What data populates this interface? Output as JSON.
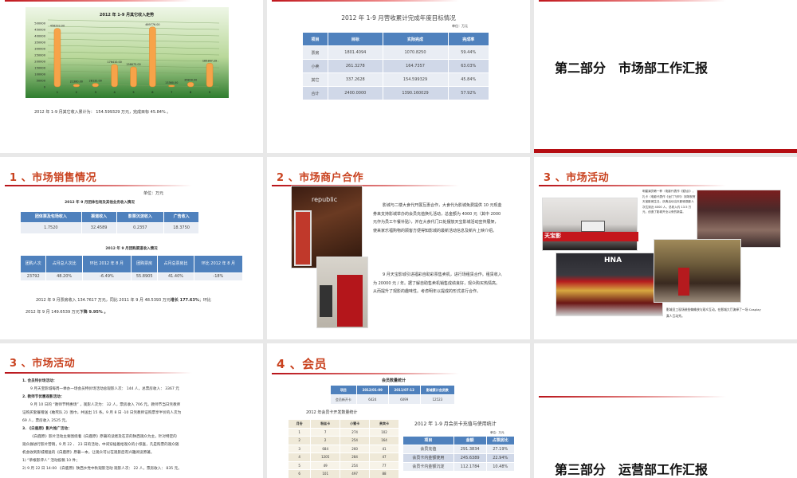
{
  "slide1": {
    "chart_data": {
      "type": "bar",
      "title": "2012 年 1-9 月其它收入走势",
      "categories": [
        "1",
        "2",
        "3",
        "4",
        "5",
        "6",
        "7",
        "8",
        "9"
      ],
      "values": [
        458293.0,
        21380.0,
        28132.0,
        176410.0,
        156675.0,
        469776.0,
        13360.0,
        35800.0,
        185367.29
      ],
      "value_labels": [
        "458293.00",
        "21380.00",
        "28132.00",
        "176410.00",
        "156675.00",
        "469776.00",
        "13360.00",
        "35800.00",
        "185367.29"
      ],
      "yticks": [
        "0",
        "50000",
        "100000",
        "150000",
        "200000",
        "250000",
        "300000",
        "350000",
        "400000",
        "450000",
        "500000"
      ],
      "ylim": [
        0,
        500000
      ],
      "xlabel": "",
      "ylabel": "",
      "grid": true,
      "colors": {
        "bar": "#f7a349",
        "bg_top": "#e3f0d4",
        "bg_bottom": "#2e7d32"
      }
    },
    "caption": "2012 年 1-9 月其它收入累计为： 154.599329 万元，完成目标 45.84% 。"
  },
  "slide2": {
    "title": "2012 年 1-9 月营收累计完成年度目标情况",
    "unit": "单位：万元",
    "headers": [
      "项目",
      "目标",
      "实际完成",
      "完成率"
    ],
    "rows": [
      [
        "票房",
        "1801.4094",
        "1070.8250",
        "59.44%"
      ],
      [
        "小卖",
        "261.3278",
        "164.7357",
        "63.03%"
      ],
      [
        "其它",
        "337.2628",
        "154.599329",
        "45.84%"
      ],
      [
        "合计",
        "2400.0000",
        "1390.160029",
        "57.92%"
      ]
    ]
  },
  "slide3": {
    "title": "第二部分　市场部工作汇报"
  },
  "slide4": {
    "title": "1 、市场销售情况",
    "unit": "单位：万元",
    "table1_title": "2012 年 9 月团体包场及其他业务收入情况",
    "table1_headers": [
      "团体票及包场收入",
      "渠道收入",
      "影票沉淀收入",
      "广告收入"
    ],
    "table1_rows": [
      [
        "1.7520",
        "32.4589",
        "0.2357",
        "18.3750"
      ]
    ],
    "table2_title": "2012 年 9 月团购渠道收入情况",
    "table2_headers": [
      "团购人次",
      "占月总人次比",
      "环比 2012 年 8 月",
      "团购票房",
      "占月总票房比",
      "环比 2012 年 8 月"
    ],
    "table2_rows": [
      [
        "23792",
        "48.20%",
        "-6.49%",
        "55.8905",
        "41.40%",
        "-18%"
      ]
    ],
    "para1": "2012 年 9 月票房收入 134.7617 万元，同比 2011 年 9 月 48.5393 万元",
    "para1_bold": "增长 177.63%",
    "para1_tail": "；环比",
    "para2": "2012 年 9 月 149.6539 万元",
    "para2_bold": "下降 9.95% 。"
  },
  "slide5": {
    "title": "2 、市场商户合作",
    "photo_sign": "republic",
    "para1": "影城与二楼大食代开展互惠合作，大食代为影城免费提供 10 元现金券来支持影城举办的会员充值换礼活动，总金额为 4000 元（其中 2000 元作为员工午餐补贴），并在大食代门口处摆放天宝影城活动宣传展架，使来家乐福购物的顾客方便得知影城的最新活动信息及新片上映介绍。",
    "para2": "9 月天宝影城引进福彩自助彩票售卖机，进行场租赁合作。租赁收入为 20000 元 / 年。据了解自助售卖机销售成绩良好，观众购买热情高。从而提升了观影的趣味性。考虑明年以提成的形式进行合作。"
  },
  "slide6": {
    "title": "3 、市场活动",
    "text1": "明星演员韩一菲（电影代表作《狐仙》）、扎卡（电影代表作《龙门飞甲》）到场祝贺天宝影城生日。庆典活动当天影城观影人次达到近 4000 人，总收入约 13.5 万元，创造了影城开业以来的新高。",
    "text2": "影城员工现场装扮蜘蛛侠与观众互动，在影城大厅演绎了一场 Cosplay 真人互动秀。",
    "banner": "天宝影",
    "hna": "HNA"
  },
  "slide7": {
    "title": "3 、市场活动",
    "lines": [
      {
        "t": "1. 会员特价场活动：",
        "b": true,
        "i": false
      },
      {
        "t": "9 月天宝影城每周一举办一场会员特价场活动总观影人次： 144 人，总票房收入： 3367 元",
        "b": false,
        "i": true
      },
      {
        "t": "2. 教师节优惠观影活动：",
        "b": true,
        "i": false
      },
      {
        "t": "9 月 10 日的 “教师节特惠场” ，观影人次为： 32 人，票房收入 706 元。教师节当日凭教师",
        "b": false,
        "i": true
      },
      {
        "t": "证购买套餐赠送《敢死队 2》围巾，共送出 15 条。9 月 8 日 -10 日凭教师证购票享半价的人次为",
        "b": false,
        "i": false
      },
      {
        "t": "69 人，票房收入 2525 元。",
        "b": false,
        "i": false
      },
      {
        "t": "3. 《白鹿原》影片推广活动：",
        "b": true,
        "i": false
      },
      {
        "t": "《白鹿原》影片活动主要围绕着《白鹿原》原著的读者及在京的陕西观众为主，针对特定的",
        "b": false,
        "i": true
      },
      {
        "t": "观众群进行影片营销，9 月 22 、 23 日的活动，中间穿插着给观众的小惊喜，凡是购票的观众随",
        "b": false,
        "i": false
      },
      {
        "t": "机会收到影城赠送的《白鹿原》原著一本，让观众可以在观影后有兴趣阅读原著。",
        "b": false,
        "i": false
      },
      {
        "t": "1) “草根影评人” 活动投稿 10 件；",
        "b": false,
        "i": false
      },
      {
        "t": "2) 9 月 22 日 14:00 《白鹿原》陕西乡党中秋观影活动 观影人次： 22 人，票房收入： 835 元。",
        "b": false,
        "i": false
      }
    ]
  },
  "slide8": {
    "title": "4 、会员",
    "count_title": "会员数量统计",
    "count_headers": [
      "项目",
      "2012/01-09",
      "2011/07-12",
      "影城累计会员数"
    ],
    "count_rows": [
      [
        "会员新开卡",
        "6424",
        "6099",
        "12523"
      ]
    ],
    "card_title": "2012 年会员卡开发数量统计",
    "card_headers": [
      "月份",
      "粉丝卡",
      "小蜜卡",
      "贵宾卡"
    ],
    "card_rows": [
      [
        "1",
        "7",
        "274",
        "102"
      ],
      [
        "2",
        "2",
        "254",
        "164"
      ],
      [
        "3",
        "684",
        "260",
        "41"
      ],
      [
        "4",
        "1205",
        "284",
        "47"
      ],
      [
        "5",
        "49",
        "254",
        "77"
      ],
      [
        "6",
        "101",
        "497",
        "88"
      ],
      [
        "7",
        "",
        "",
        ""
      ]
    ],
    "recharge_title": "2012 年 1-9 月会员卡充值与使用统计",
    "recharge_unit": "单位：万元",
    "recharge_headers": [
      "项目",
      "金额",
      "占票房比"
    ],
    "recharge_rows": [
      [
        "会员充值",
        "291.3834",
        "27.19%"
      ],
      [
        "会员卡内金额使用",
        "245.6389",
        "22.94%"
      ],
      [
        "会员卡内金额沉淀",
        "112.1784",
        "10.48%"
      ]
    ]
  },
  "slide9": {
    "title": "第三部分　运营部工作汇报"
  }
}
